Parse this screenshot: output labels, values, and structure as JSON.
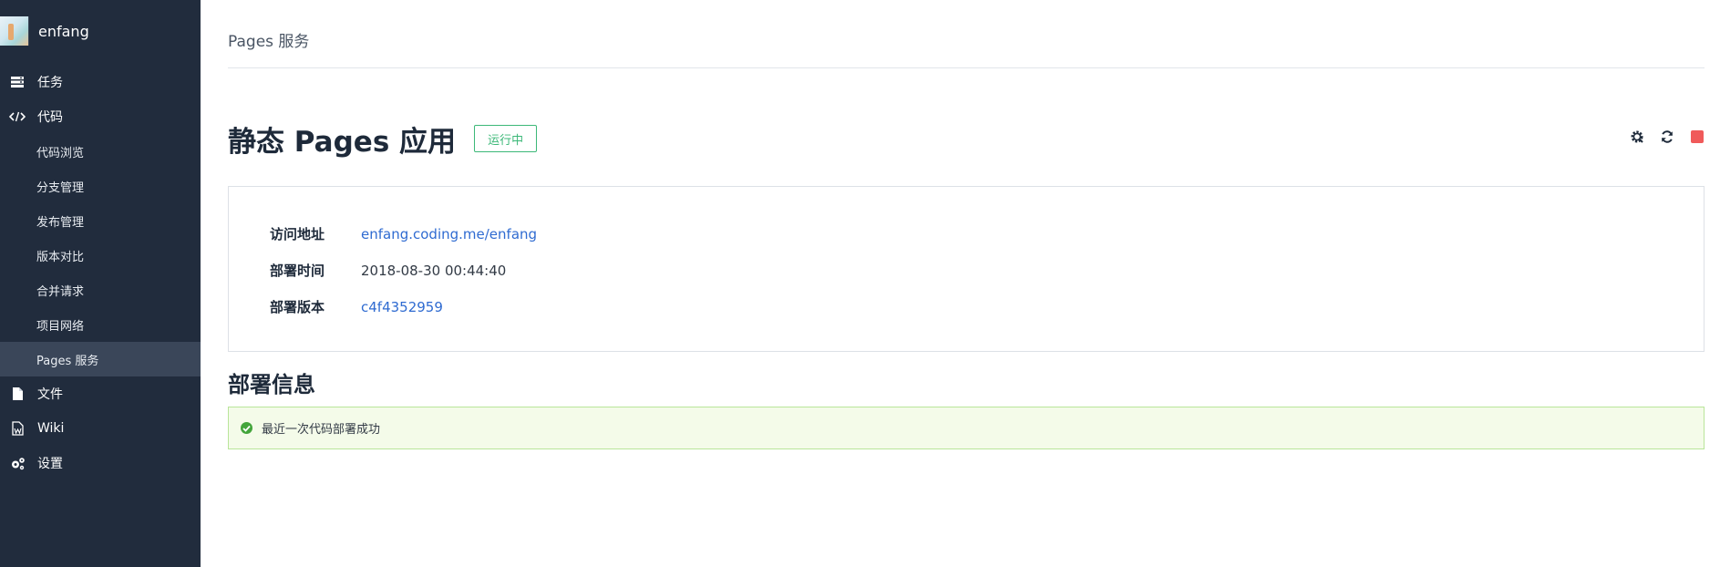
{
  "project": {
    "name": "enfang"
  },
  "nav": {
    "tasks": "任务",
    "code": "代码",
    "code_sub": [
      "代码浏览",
      "分支管理",
      "发布管理",
      "版本对比",
      "合并请求",
      "项目网络",
      "Pages 服务"
    ],
    "files": "文件",
    "wiki": "Wiki",
    "settings": "设置",
    "active": "Pages 服务"
  },
  "header": {
    "breadcrumb": "Pages 服务"
  },
  "page": {
    "title": "静态 Pages 应用",
    "status": "运行中",
    "actions": [
      "settings-gear-icon",
      "refresh-icon",
      "stop-icon"
    ]
  },
  "info": {
    "access_label": "访问地址",
    "access_value": "enfang.coding.me/enfang",
    "time_label": "部署时间",
    "time_value": "2018-08-30 00:44:40",
    "version_label": "部署版本",
    "version_value": "c4f4352959"
  },
  "deploy": {
    "section_title": "部署信息",
    "message": "最近一次代码部署成功"
  },
  "colors": {
    "sidebar_bg": "#212c3d",
    "sidebar_active": "#3a4659",
    "link": "#2f6bd1",
    "running": "#3cb878",
    "stop": "#f05a5a",
    "success_bg": "#f4fbe9",
    "success_border": "#b9e59a"
  }
}
